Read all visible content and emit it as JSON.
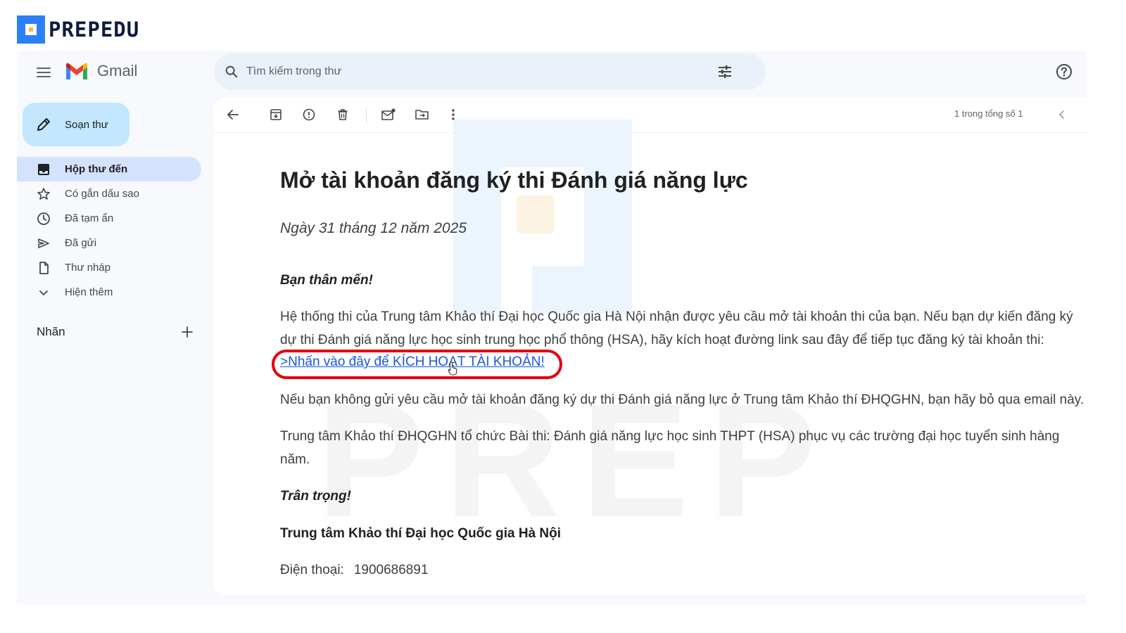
{
  "brand": {
    "name": "PREPEDU",
    "watermark": "PREP",
    "colors": {
      "blue": "#2d7ff9",
      "orange": "#ffb547"
    }
  },
  "app": {
    "name": "Gmail"
  },
  "search": {
    "placeholder": "Tìm kiếm trong thư"
  },
  "compose": {
    "label": "Soạn thư"
  },
  "sidebar": {
    "items": [
      {
        "label": "Hộp thư đến",
        "icon": "inbox-icon",
        "active": true
      },
      {
        "label": "Có gắn dấu sao",
        "icon": "star-icon"
      },
      {
        "label": "Đã tạm ẩn",
        "icon": "clock-icon"
      },
      {
        "label": "Đã gửi",
        "icon": "send-icon"
      },
      {
        "label": "Thư nháp",
        "icon": "draft-icon"
      },
      {
        "label": "Hiện thêm",
        "icon": "chevron-down-icon"
      }
    ],
    "labels_title": "Nhãn"
  },
  "toolbar": {
    "pager": "1 trong tổng số 1"
  },
  "email": {
    "subject": "Mở tài khoản đăng ký thi Đánh giá năng lực",
    "date": "Ngày 31 tháng 12 năm 2025",
    "greeting": "Bạn thân mến!",
    "para1_line1": "Hệ thống thi của Trung tâm Khảo thí Đại học Quốc gia Hà Nội nhận được yêu cầu mở tài khoản thi của bạn. Nếu bạn dự kiến đăng ký",
    "para1_line2": "dự thi Đánh giá năng lực học sinh trung học phổ thông (HSA), hãy kích hoạt đường link sau đây để tiếp tục đăng ký tài khoản thi:",
    "activation_link": ">Nhấn vào đây để KÍCH HOẠT TÀI KHOẢN!",
    "para2": "Nếu bạn không gửi yêu cầu mở tài khoản đăng ký dự thi Đánh giá năng lực ở Trung tâm Khảo thí ĐHQGHN, bạn hãy bỏ qua email này.",
    "para3_line1": "Trung tâm Khảo thí ĐHQGHN tổ chức Bài thi: Đánh giá năng lực học sinh THPT (HSA) phục vụ các trường đại học tuyển sinh hàng",
    "para3_line2": "năm.",
    "signoff": "Trân trọng!",
    "org": "Trung tâm Khảo thí Đại học Quốc gia Hà Nội",
    "phone_label": "Điện thoại:",
    "phone": "1900686891"
  },
  "highlight_color": "#e3000f"
}
